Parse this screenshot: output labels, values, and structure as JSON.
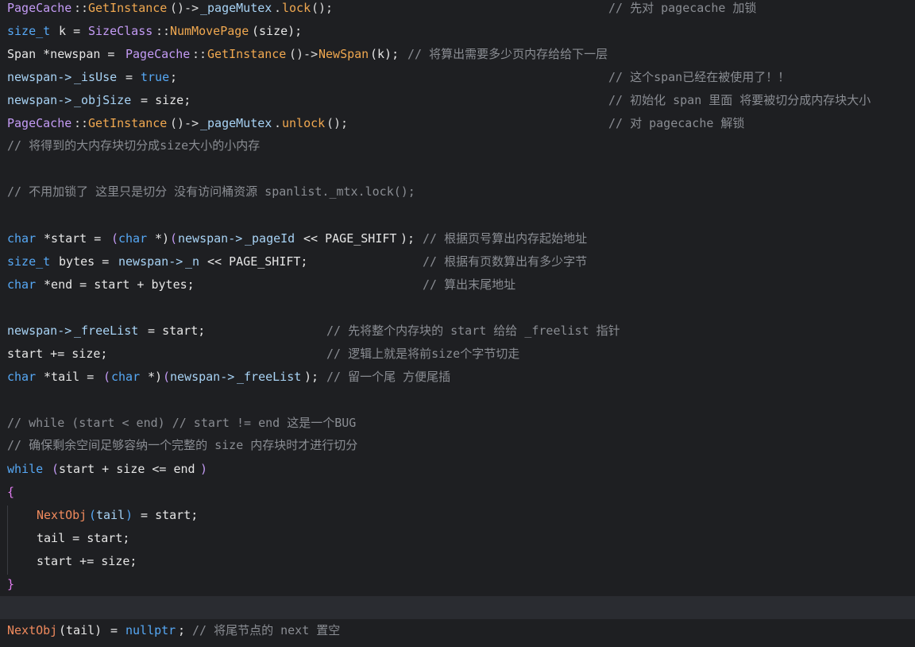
{
  "code": {
    "l1": {
      "a": "PageCache",
      "b": "::",
      "c": "GetInstance",
      "d": "()->",
      "e": "_pageMutex",
      "f": ".",
      "g": "lock",
      "h": "();",
      "comment": "// 先对 pagecache 加锁"
    },
    "l2": {
      "a": "size_t",
      "b": " k = ",
      "c": "SizeClass",
      "d": "::",
      "e": "NumMovePage",
      "f": "(size);"
    },
    "l3": {
      "a": "Span *newspan = ",
      "b": "PageCache",
      "c": "::",
      "d": "GetInstance",
      "e": "()->",
      "f": "NewSpan",
      "g": "(k);",
      "comment": "// 将算出需要多少页内存给给下一层"
    },
    "l4": {
      "a": "newspan->",
      "b": "_isUse",
      "c": " = ",
      "d": "true",
      "e": ";",
      "comment": "// 这个span已经在被使用了！！"
    },
    "l5": {
      "a": "newspan->",
      "b": "_objSize",
      "c": " = size;",
      "comment": "// 初始化 span 里面 将要被切分成内存块大小"
    },
    "l6": {
      "a": "PageCache",
      "b": "::",
      "c": "GetInstance",
      "d": "()->",
      "e": "_pageMutex",
      "f": ".",
      "g": "unlock",
      "h": "();",
      "comment": "// 对 pagecache 解锁"
    },
    "l7": {
      "comment": "// 将得到的大内存块切分成size大小的小内存"
    },
    "l9": {
      "comment": "// 不用加锁了 这里只是切分 没有访问桶资源 spanlist._mtx.lock();"
    },
    "l11": {
      "a": "char",
      "b": " *start = ",
      "c": "(",
      "d": "char",
      "e": " *)",
      "f": "(",
      "g": "newspan->",
      "h": "_pageId",
      "i": " << PAGE_SHIFT",
      "j": ");",
      "comment": "// 根据页号算出内存起始地址"
    },
    "l12": {
      "a": "size_t",
      "b": " bytes = ",
      "c": "newspan->",
      "d": "_n",
      "e": " << PAGE_SHIFT;",
      "comment": "// 根据有页数算出有多少字节"
    },
    "l13": {
      "a": "char",
      "b": " *end = start + bytes;",
      "comment": "// 算出末尾地址"
    },
    "l15": {
      "a": "newspan->",
      "b": "_freeList",
      "c": " = start;",
      "comment": "// 先将整个内存块的 start 给给 _freelist 指针"
    },
    "l16": {
      "a": "start += size;",
      "comment": "// 逻辑上就是将前size个字节切走"
    },
    "l17": {
      "a": "char",
      "b": " *tail = ",
      "c": "(",
      "d": "char",
      "e": " *)",
      "f": "(",
      "g": "newspan->",
      "h": "_freeList",
      "i": ");",
      "comment": "// 留一个尾 方便尾插"
    },
    "l19": {
      "comment": "// while (start < end) // start != end 这是一个BUG"
    },
    "l20": {
      "comment": "// 确保剩余空间足够容纳一个完整的 size 内存块时才进行切分"
    },
    "l21": {
      "a": "while",
      "b": " ",
      "c": "(",
      "d": "start + size <= end",
      "e": ")"
    },
    "l22": {
      "a": "{"
    },
    "l23": {
      "a": "NextObj",
      "b": "(",
      "c": "tail",
      "d": ")",
      "e": " = start;"
    },
    "l24": {
      "a": "tail = start;"
    },
    "l25": {
      "a": "start += size;"
    },
    "l26": {
      "a": "}"
    },
    "l28": {
      "a": "NextObj",
      "b": "(tail)",
      "c": " = ",
      "d": "nullptr",
      "e": ";",
      "comment": "// 将尾节点的 next 置空"
    }
  },
  "colors": {
    "background": "#1e1f22",
    "current_line": "#2a2c31",
    "keyword": "#56a8f5",
    "identifier": "#a8d3f5",
    "class": "#c49bf5",
    "function": "#f0a850",
    "comment": "#8a8d93",
    "brace": "#e07cf0"
  }
}
